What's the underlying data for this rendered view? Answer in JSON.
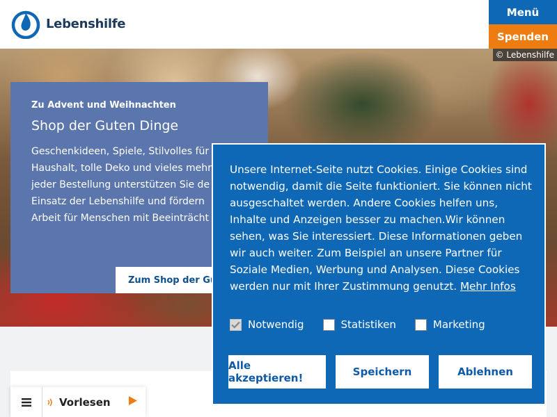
{
  "header": {
    "logo_text": "Lebenshilfe",
    "menu_label": "Menü",
    "donate_label": "Spenden"
  },
  "hero": {
    "copyright": "© Lebenshilfe",
    "kicker": "Zu Advent und Weihnachten",
    "title": "Shop der Guten Dinge",
    "text": "Geschenkideen, Spiele, Stilvolles für\nHaushalt, tolle Deko und vieles mehr\njeder Bestellung unterstützen Sie de\nEinsatz der Lebenshilfe und fördern\nArbeit für Menschen mit Beeinträcht",
    "link_label": "Zum Shop der Gut"
  },
  "reader": {
    "label": "Vorlesen"
  },
  "cookie": {
    "text": "Unsere Internet-Seite nutzt Cookies. Einige Cookies sind notwendig, damit die Seite funktioniert. Sie können nicht ausgeschaltet werden. Andere Cookies helfen uns, Inhalte und Anzeigen besser zu machen.Wir können sehen, was Sie interessiert. Diese Informationen geben wir auch weiter. Zum Beispiel an unsere Partner für Soziale Medien, Werbung und Analysen. Diese Cookies werden nur mit Ihrer Zustimmung genutzt.",
    "more_link": "Mehr Infos",
    "checks": {
      "necessary": "Notwendig",
      "statistics": "Statistiken",
      "marketing": "Marketing"
    },
    "buttons": {
      "accept_all": "Alle akzeptieren!",
      "save": "Speichern",
      "decline": "Ablehnen"
    }
  },
  "colors": {
    "brand_blue": "#0e68b6",
    "donate_orange": "#ee7d11",
    "promo_blue": "#5a76ad"
  }
}
